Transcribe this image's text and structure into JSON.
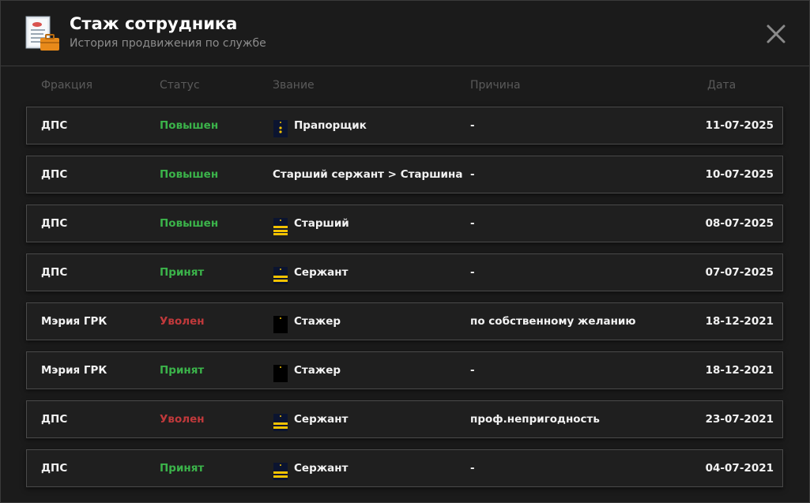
{
  "header": {
    "title": "Стаж сотрудника",
    "subtitle": "История продвижения по службе"
  },
  "columns": {
    "faction": "Фракция",
    "status": "Статус",
    "rank": "Звание",
    "reason": "Причина",
    "date": "Дата"
  },
  "colors": {
    "promoted": "#3bb34a",
    "accepted": "#3bb34a",
    "fired": "#c0393b",
    "stripe": "#f2c200"
  },
  "rows": [
    {
      "faction": "ДПС",
      "status": "Повышен",
      "status_type": "green",
      "rank_icon": "warrant-officer-icon",
      "rank": "Прапорщик",
      "reason": "-",
      "date": "11-07-2025"
    },
    {
      "faction": "ДПС",
      "status": "Повышен",
      "status_type": "green",
      "rank_icon": "",
      "rank": "Старший сержант > Старшина",
      "reason": "-",
      "date": "10-07-2025"
    },
    {
      "faction": "ДПС",
      "status": "Повышен",
      "status_type": "green",
      "rank_icon": "senior-stripes-icon",
      "rank": "Старший",
      "reason": "-",
      "date": "08-07-2025"
    },
    {
      "faction": "ДПС",
      "status": "Принят",
      "status_type": "green",
      "rank_icon": "sergeant-stripes-icon",
      "rank": "Сержант",
      "reason": "-",
      "date": "07-07-2025"
    },
    {
      "faction": "Мэрия ГРК",
      "status": "Уволен",
      "status_type": "red",
      "rank_icon": "trainee-icon",
      "rank": "Стажер",
      "reason": "по собственному желанию",
      "date": "18-12-2021"
    },
    {
      "faction": "Мэрия ГРК",
      "status": "Принят",
      "status_type": "green",
      "rank_icon": "trainee-icon",
      "rank": "Стажер",
      "reason": "-",
      "date": "18-12-2021"
    },
    {
      "faction": "ДПС",
      "status": "Уволен",
      "status_type": "red",
      "rank_icon": "sergeant-stripes-icon",
      "rank": "Сержант",
      "reason": "проф.непригодность",
      "date": "23-07-2021"
    },
    {
      "faction": "ДПС",
      "status": "Принят",
      "status_type": "green",
      "rank_icon": "sergeant-stripes-icon",
      "rank": "Сержант",
      "reason": "-",
      "date": "04-07-2021"
    }
  ]
}
